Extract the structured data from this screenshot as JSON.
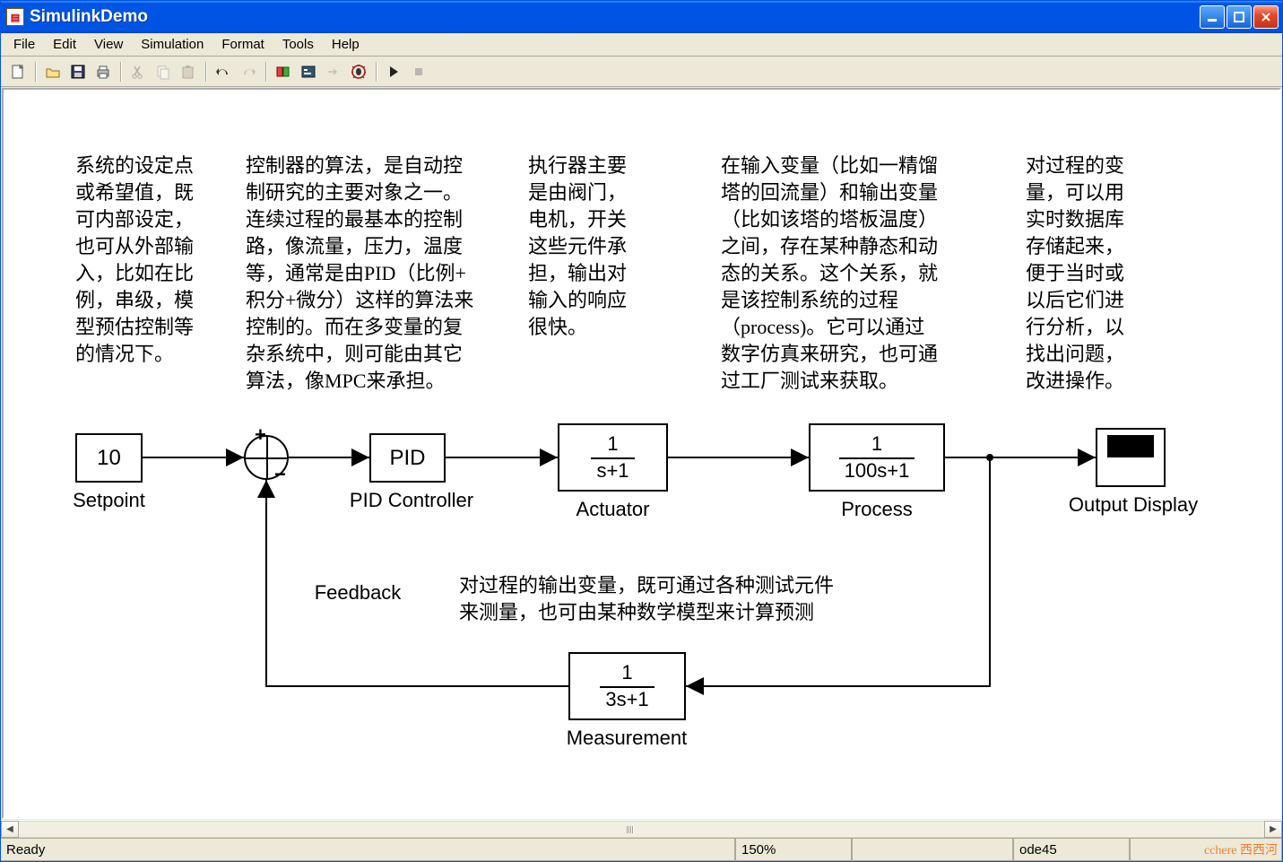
{
  "window": {
    "title": "SimulinkDemo"
  },
  "menu": {
    "file": "File",
    "edit": "Edit",
    "view": "View",
    "simulation": "Simulation",
    "format": "Format",
    "tools": "Tools",
    "help": "Help"
  },
  "annotations": {
    "setpoint": "系统的设定点\n或希望值，既\n可内部设定，\n也可从外部输\n入，比如在比\n例，串级，模\n型预估控制等\n的情况下。",
    "controller": "控制器的算法，是自动控\n制研究的主要对象之一。\n连续过程的最基本的控制\n路，像流量，压力，温度\n等，通常是由PID（比例+\n积分+微分）这样的算法来\n控制的。而在多变量的复\n杂系统中，则可能由其它\n算法，像MPC来承担。",
    "actuator": "执行器主要\n是由阀门，\n电机，开关\n这些元件承\n担，输出对\n输入的响应\n很快。",
    "process": "在输入变量（比如一精馏\n塔的回流量）和输出变量\n（比如该塔的塔板温度）\n之间，存在某种静态和动\n态的关系。这个关系，就\n是该控制系统的过程\n（process)。它可以通过\n数字仿真来研究，也可通\n过工厂测试来获取。",
    "output": "对过程的变\n量，可以用\n实时数据库\n存储起来，\n便于当时或\n以后它们进\n行分析，以\n找出问题，\n改进操作。",
    "measurement": "对过程的输出变量，既可通过各种测试元件\n来测量，也可由某种数学模型来计算预测"
  },
  "blocks": {
    "setpoint": {
      "value": "10",
      "label": "Setpoint"
    },
    "sum": {
      "plus": "+",
      "minus": "−"
    },
    "pid": {
      "text": "PID",
      "label": "PID Controller"
    },
    "actuator": {
      "num": "1",
      "den": "s+1",
      "label": "Actuator"
    },
    "process": {
      "num": "1",
      "den": "100s+1",
      "label": "Process"
    },
    "scope": {
      "label": "Output Display"
    },
    "measurement": {
      "num": "1",
      "den": "3s+1",
      "label": "Measurement"
    },
    "feedback": {
      "label": "Feedback"
    }
  },
  "status": {
    "ready": "Ready",
    "zoom": "150%",
    "solver": "ode45"
  },
  "watermark": "cchere 西西河",
  "chart_data": {
    "type": "diagram",
    "description": "Closed-loop PID control block diagram (Simulink model)",
    "blocks": [
      {
        "id": "setpoint",
        "type": "Constant",
        "value": 10,
        "label": "Setpoint"
      },
      {
        "id": "sum",
        "type": "Sum",
        "signs": [
          "+",
          "-"
        ]
      },
      {
        "id": "pid",
        "type": "PID Controller",
        "label": "PID Controller"
      },
      {
        "id": "actuator",
        "type": "TransferFcn",
        "numerator": [
          1
        ],
        "denominator": [
          1,
          1
        ],
        "display": "1/(s+1)",
        "label": "Actuator"
      },
      {
        "id": "process",
        "type": "TransferFcn",
        "numerator": [
          1
        ],
        "denominator": [
          100,
          1
        ],
        "display": "1/(100s+1)",
        "label": "Process"
      },
      {
        "id": "scope",
        "type": "Scope",
        "label": "Output Display"
      },
      {
        "id": "measurement",
        "type": "TransferFcn",
        "numerator": [
          1
        ],
        "denominator": [
          3,
          1
        ],
        "display": "1/(3s+1)",
        "label": "Measurement"
      }
    ],
    "connections": [
      {
        "from": "setpoint",
        "to": "sum",
        "port": "+"
      },
      {
        "from": "sum",
        "to": "pid"
      },
      {
        "from": "pid",
        "to": "actuator"
      },
      {
        "from": "actuator",
        "to": "process"
      },
      {
        "from": "process",
        "to": "scope"
      },
      {
        "from": "process",
        "to": "measurement",
        "branch": true
      },
      {
        "from": "measurement",
        "to": "sum",
        "port": "-",
        "label": "Feedback"
      }
    ]
  }
}
